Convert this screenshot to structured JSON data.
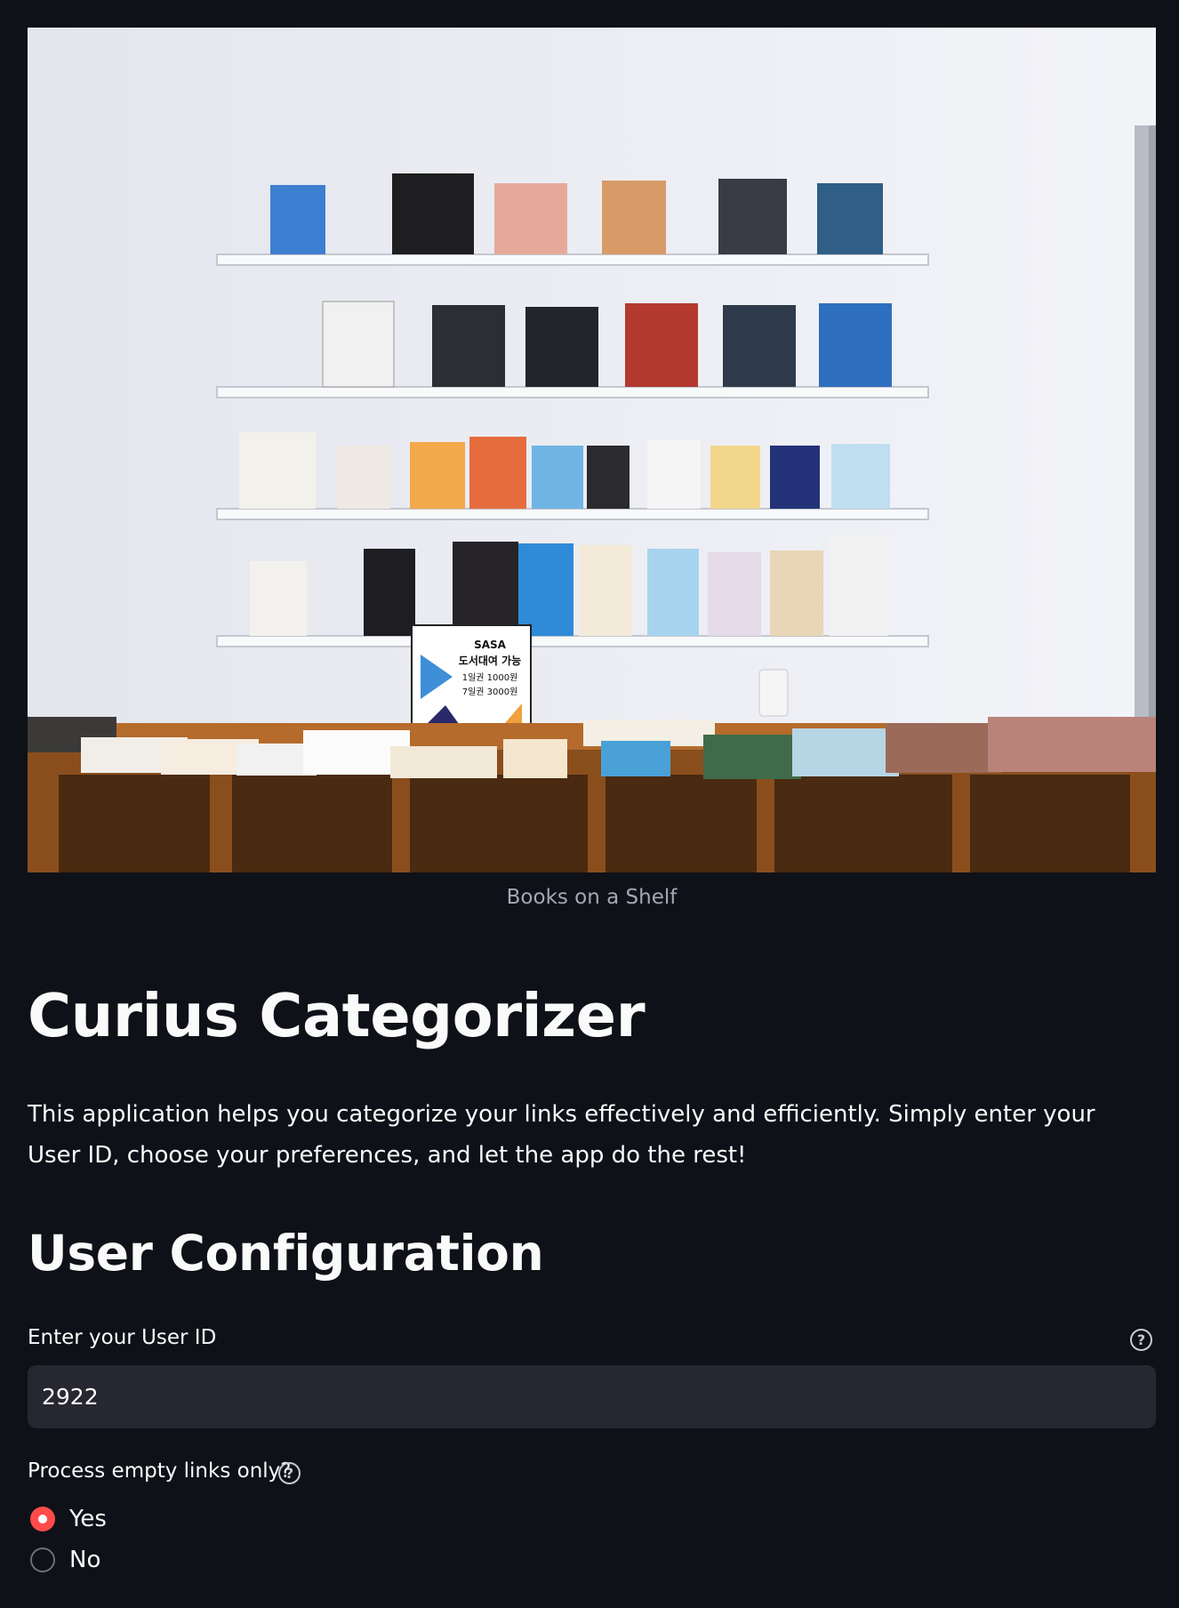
{
  "hero": {
    "caption": "Books on a Shelf",
    "sign_lines": [
      "SASA",
      "도서대여 가능",
      "1일권 1000원",
      "7일권 3000원"
    ]
  },
  "main": {
    "title": "Curius Categorizer",
    "description": "This application helps you categorize your links effectively and efficiently. Simply enter your User ID, choose your preferences, and let the app do the rest!",
    "section_title": "User Configuration"
  },
  "user_id": {
    "label": "Enter your User ID",
    "value": "2922",
    "help_icon": "question-circle-icon"
  },
  "empty_links": {
    "label": "Process empty links only?",
    "help_icon": "question-circle-icon",
    "options": [
      "Yes",
      "No"
    ],
    "selected": "Yes"
  },
  "colors": {
    "background": "#0e1117",
    "accent": "#ff4b4b",
    "input_bg": "#262730",
    "caption": "#a3a8b4"
  }
}
